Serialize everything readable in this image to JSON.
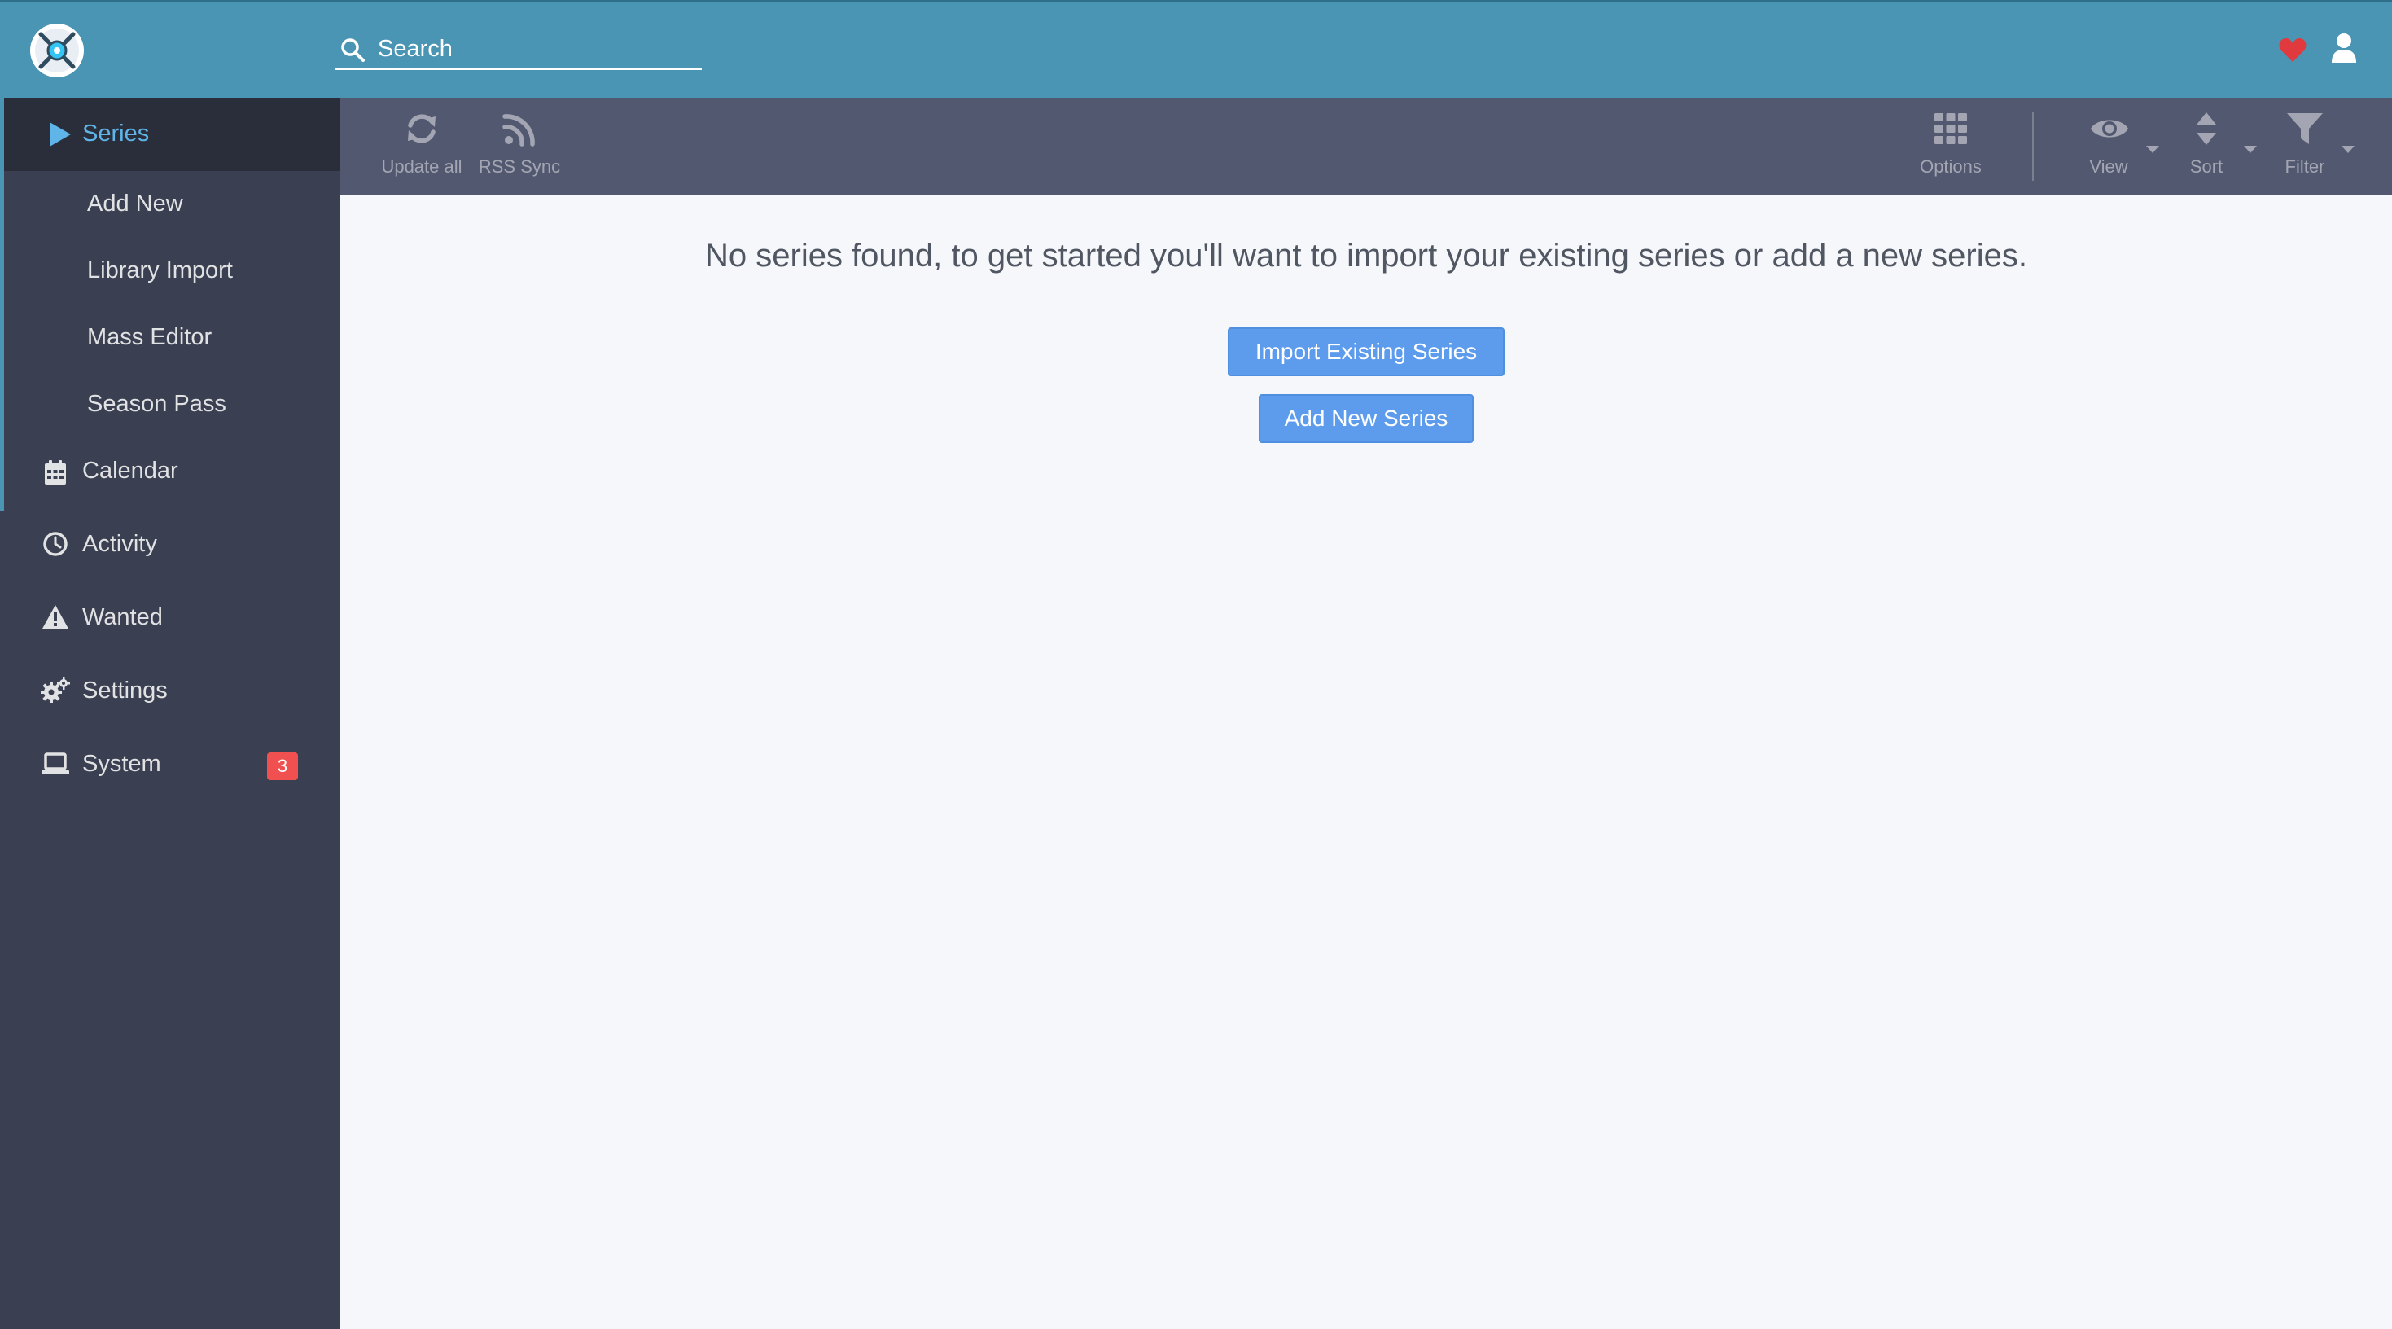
{
  "header": {
    "search_placeholder": "Search",
    "logo_icon": "sonarr-logo-icon",
    "donate_icon": "heart-icon",
    "user_icon": "user-icon",
    "colors": {
      "bar": "#4a95b4",
      "heart": "#e03a3e"
    }
  },
  "sidebar": {
    "active": "Series",
    "series_label": "Series",
    "series_submenu": [
      {
        "label": "Add New"
      },
      {
        "label": "Library Import"
      },
      {
        "label": "Mass Editor"
      },
      {
        "label": "Season Pass"
      }
    ],
    "items": [
      {
        "label": "Calendar",
        "icon": "calendar-icon"
      },
      {
        "label": "Activity",
        "icon": "clock-icon"
      },
      {
        "label": "Wanted",
        "icon": "warning-icon"
      },
      {
        "label": "Settings",
        "icon": "gears-icon"
      },
      {
        "label": "System",
        "icon": "laptop-icon",
        "badge": "3"
      }
    ],
    "colors": {
      "background": "#3a3f51",
      "active_text": "#5fb4e8",
      "badge": "#f05050"
    }
  },
  "toolbar": {
    "update_all": "Update all",
    "rss_sync": "RSS Sync",
    "options": "Options",
    "view": "View",
    "sort": "Sort",
    "filter": "Filter"
  },
  "main": {
    "empty_message": "No series found, to get started you'll want to import your existing series or add a new series.",
    "import_button": "Import Existing Series",
    "add_button": "Add New Series",
    "colors": {
      "button": "#5d9cec"
    }
  }
}
